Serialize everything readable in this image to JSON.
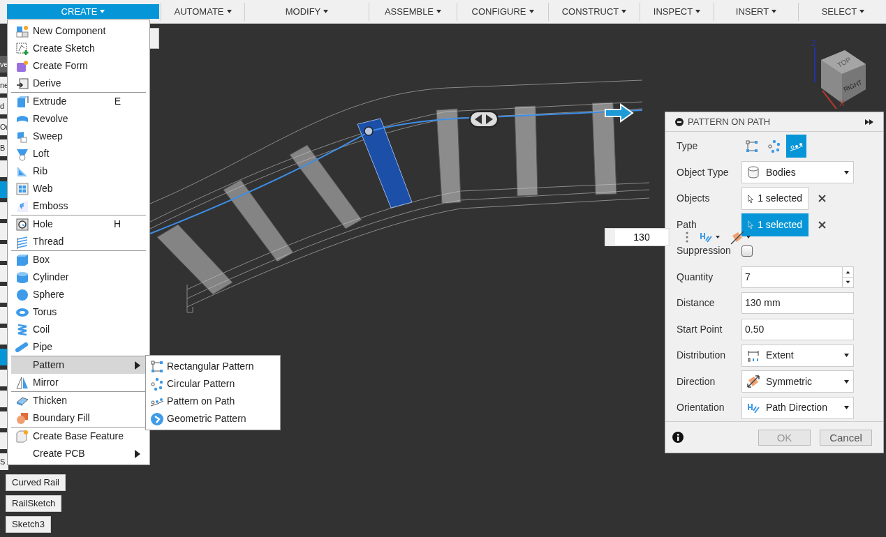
{
  "toolbar": {
    "tabs": [
      {
        "label": "CREATE",
        "selected": true
      },
      {
        "label": "AUTOMATE",
        "selected": false
      },
      {
        "label": "MODIFY",
        "selected": false
      },
      {
        "label": "ASSEMBLE",
        "selected": false
      },
      {
        "label": "CONFIGURE",
        "selected": false
      },
      {
        "label": "CONSTRUCT",
        "selected": false
      },
      {
        "label": "INSPECT",
        "selected": false
      },
      {
        "label": "INSERT",
        "selected": false
      },
      {
        "label": "SELECT",
        "selected": false
      }
    ]
  },
  "browser": {
    "rows": [
      {
        "label": "ve",
        "selected": false
      },
      {
        "label": "ne",
        "selected": false
      },
      {
        "label": "d",
        "selected": false
      },
      {
        "label": "Or",
        "selected": false
      },
      {
        "label": "B",
        "selected": false
      },
      {
        "selected": false
      },
      {
        "selected": true
      },
      {
        "selected": false
      },
      {
        "selected": false
      },
      {
        "selected": false
      },
      {
        "selected": false
      },
      {
        "selected": false
      },
      {
        "selected": false
      },
      {
        "selected": false
      },
      {
        "selected": true
      },
      {
        "selected": false
      },
      {
        "selected": false
      },
      {
        "selected": false
      },
      {
        "selected": false
      },
      {
        "label": "S",
        "selected": false
      },
      {
        "label": "Curved Rail",
        "selected": false
      },
      {
        "label": "RailSketch",
        "selected": false
      },
      {
        "label": "Sketch3",
        "selected": false
      }
    ]
  },
  "menu": {
    "groups": [
      [
        {
          "label": "New Component"
        },
        {
          "label": "Create Sketch"
        },
        {
          "label": "Create Form"
        },
        {
          "label": "Derive"
        }
      ],
      [
        {
          "label": "Extrude",
          "shortcut": "E"
        },
        {
          "label": "Revolve"
        },
        {
          "label": "Sweep"
        },
        {
          "label": "Loft"
        },
        {
          "label": "Rib"
        },
        {
          "label": "Web"
        },
        {
          "label": "Emboss"
        }
      ],
      [
        {
          "label": "Hole",
          "shortcut": "H"
        },
        {
          "label": "Thread"
        }
      ],
      [
        {
          "label": "Box"
        },
        {
          "label": "Cylinder"
        },
        {
          "label": "Sphere"
        },
        {
          "label": "Torus"
        },
        {
          "label": "Coil"
        },
        {
          "label": "Pipe"
        }
      ],
      [
        {
          "label": "Pattern",
          "selected": true,
          "submenu": true
        },
        {
          "label": "Mirror"
        }
      ],
      [
        {
          "label": "Thicken"
        },
        {
          "label": "Boundary Fill"
        }
      ],
      [
        {
          "label": "Create Base Feature"
        },
        {
          "label": "Create PCB",
          "submenu": true
        }
      ]
    ]
  },
  "submenu": {
    "items": [
      {
        "label": "Rectangular Pattern"
      },
      {
        "label": "Circular Pattern"
      },
      {
        "label": "Pattern on Path"
      },
      {
        "label": "Geometric Pattern"
      }
    ]
  },
  "viewcube": {
    "faces": [
      "TOP",
      "RIGHT"
    ],
    "axes": [
      {
        "label": "Z",
        "color": "#2233aa"
      },
      {
        "label": "X",
        "color": "#c0392b"
      }
    ]
  },
  "floating_input": {
    "value": "130"
  },
  "dialog": {
    "title": "PATTERN ON PATH",
    "fields": [
      {
        "kind": "type",
        "label": "Type",
        "options": [
          {
            "selected": false
          },
          {
            "selected": false
          },
          {
            "selected": true
          }
        ]
      },
      {
        "kind": "dropdown",
        "label": "Object Type",
        "value": "Bodies"
      },
      {
        "kind": "selection",
        "label": "Objects",
        "value": "1 selected",
        "active": false
      },
      {
        "kind": "selection",
        "label": "Path",
        "value": "1 selected",
        "active": true
      },
      {
        "kind": "checkbox",
        "label": "Suppression",
        "checked": false
      },
      {
        "kind": "spinner",
        "label": "Quantity",
        "value": "7"
      },
      {
        "kind": "text",
        "label": "Distance",
        "value": "130 mm"
      },
      {
        "kind": "text",
        "label": "Start Point",
        "value": "0.50"
      },
      {
        "kind": "dropdown",
        "label": "Distribution",
        "value": "Extent"
      },
      {
        "kind": "dropdown",
        "label": "Direction",
        "value": "Symmetric"
      },
      {
        "kind": "dropdown",
        "label": "Orientation",
        "value": "Path Direction"
      }
    ],
    "buttons": [
      "OK",
      "Cancel"
    ]
  }
}
